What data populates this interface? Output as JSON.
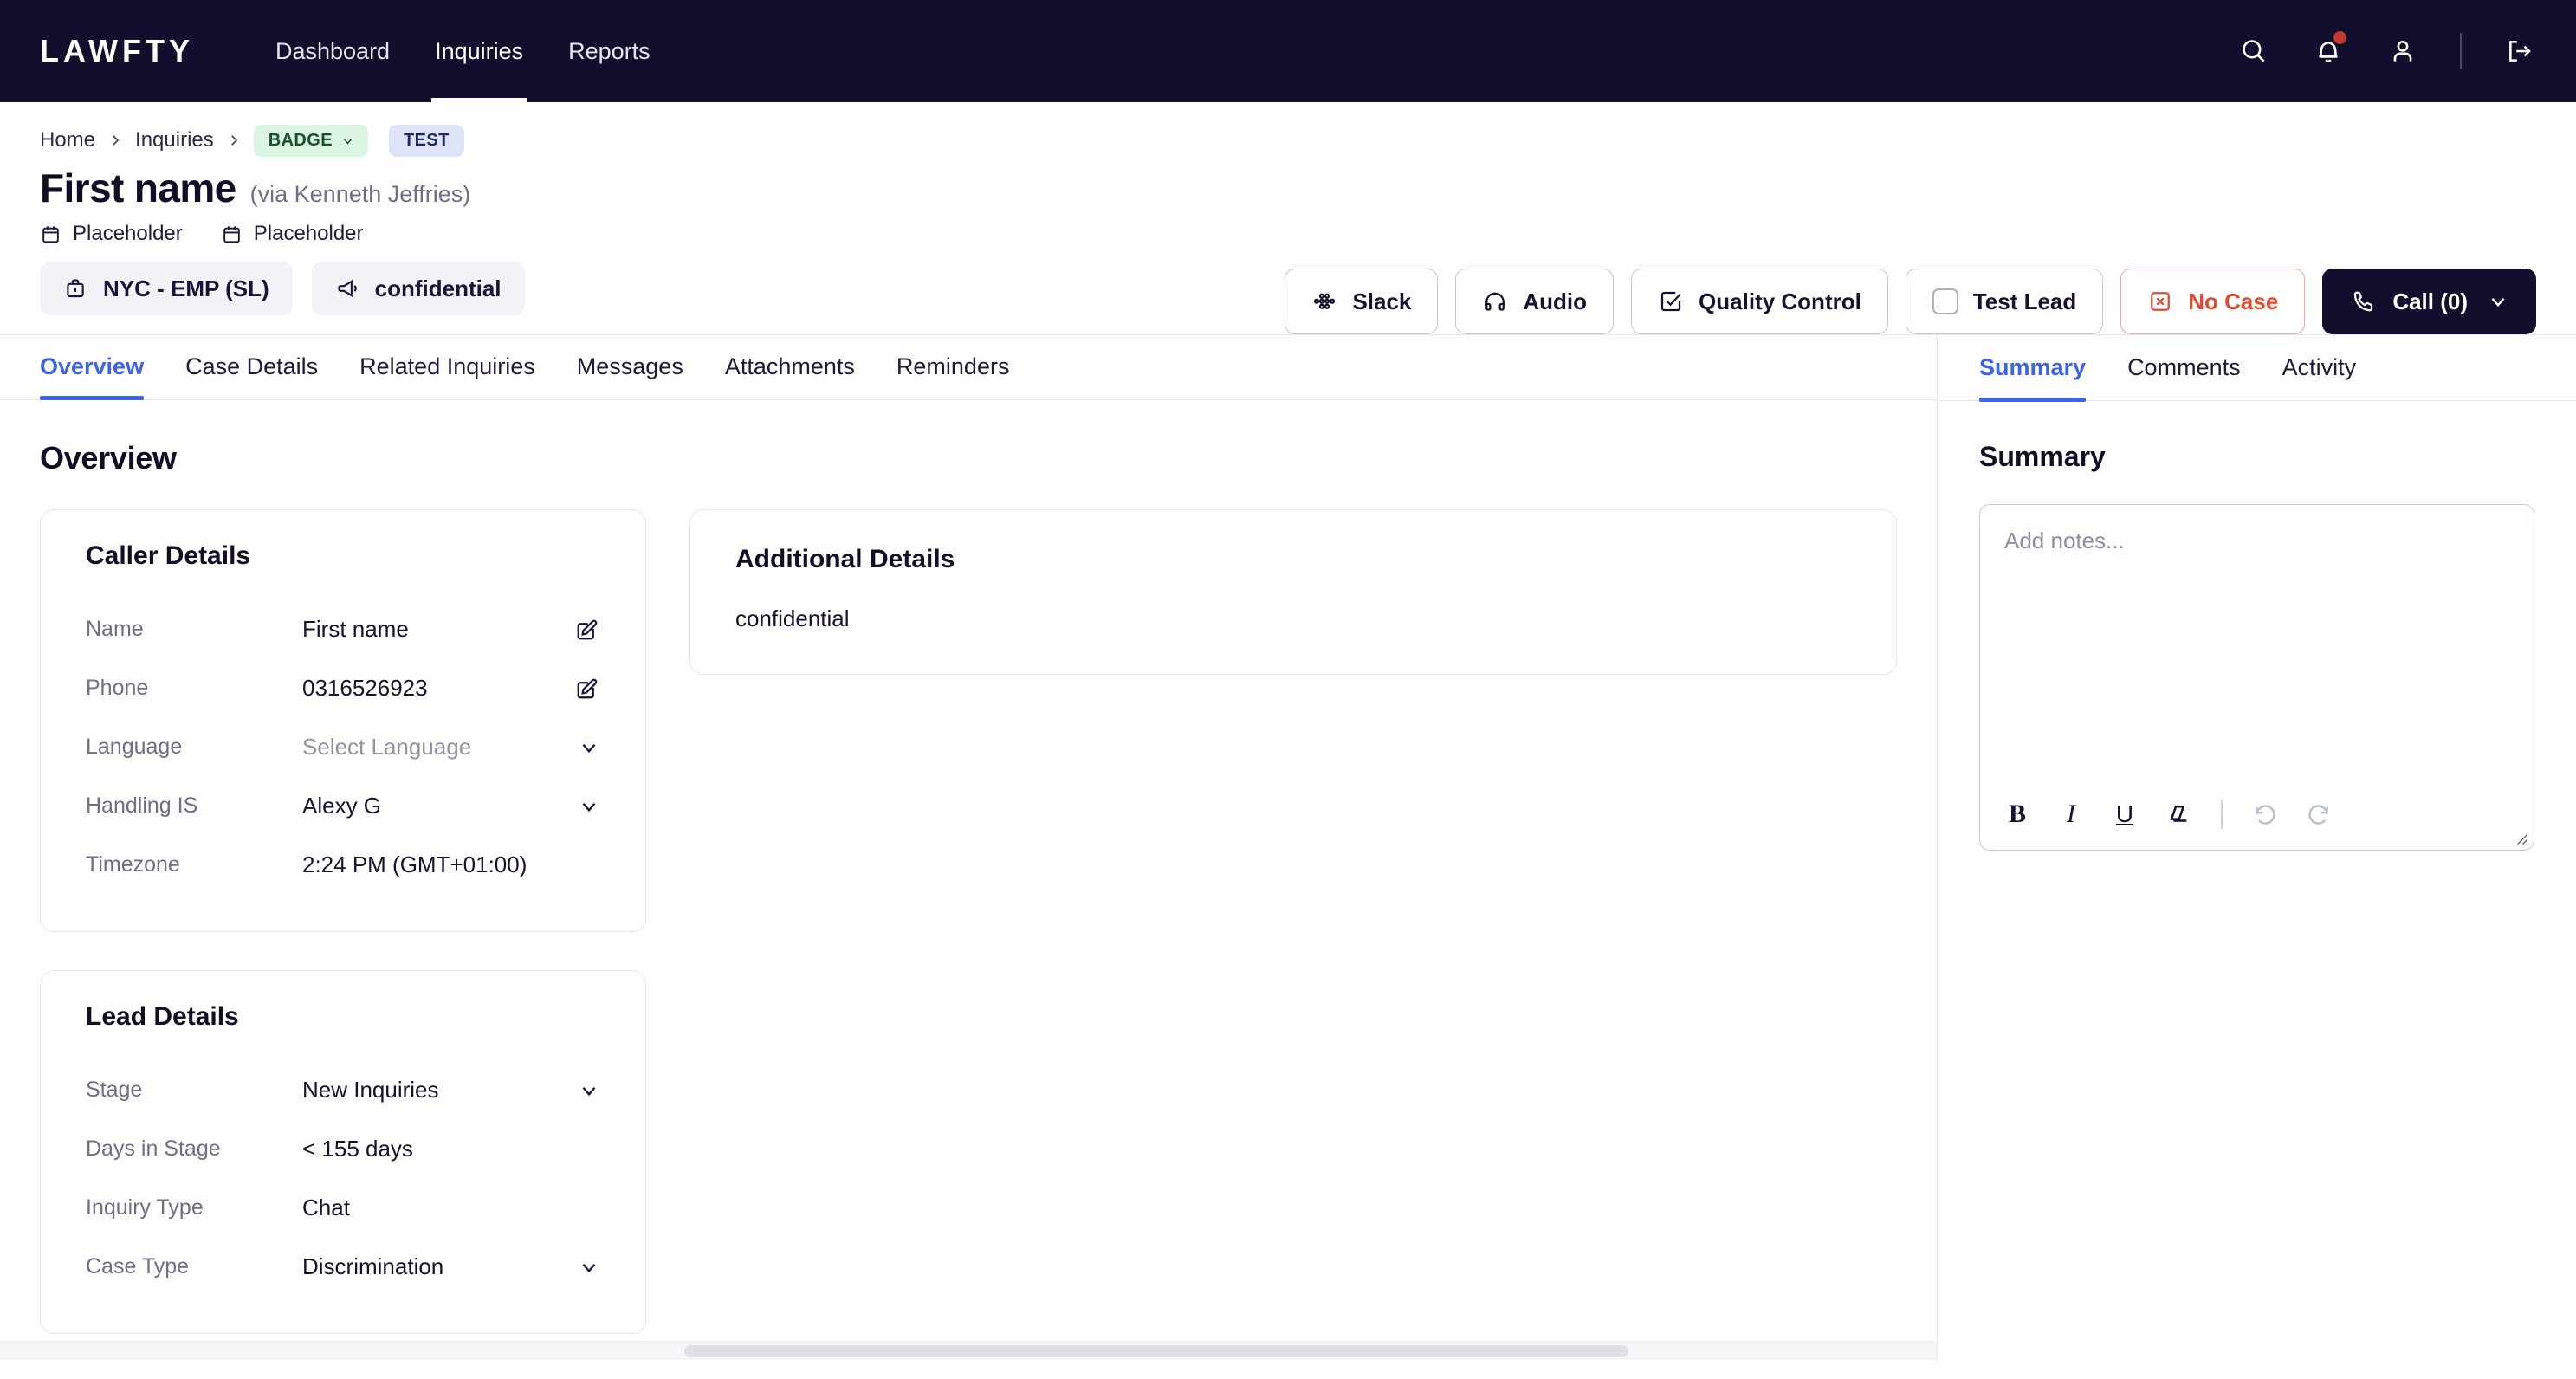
{
  "topnav": {
    "logo": "LAWFTY",
    "links": [
      {
        "label": "Dashboard",
        "active": false
      },
      {
        "label": "Inquiries",
        "active": true
      },
      {
        "label": "Reports",
        "active": false
      }
    ],
    "icons": [
      "search-icon",
      "notifications-bell-icon",
      "user-account-icon",
      "logout-icon"
    ],
    "notification_dot_color": "#c0392b"
  },
  "header": {
    "breadcrumb": {
      "home": "Home",
      "inquiries": "Inquiries",
      "badge": "BADGE",
      "test": "TEST",
      "badge_bg": "#dcf5e3",
      "badge_color": "#14532d",
      "test_bg": "#dfe3f7",
      "test_color": "#1d2a5e"
    },
    "title": "First name",
    "title_via": "(via Kenneth Jeffries)",
    "meta": [
      {
        "icon": "calendar-icon",
        "label": "Placeholder"
      },
      {
        "icon": "calendar-icon",
        "label": "Placeholder"
      }
    ],
    "actions": [
      {
        "id": "slack",
        "label": "Slack",
        "icon": "slack-icon",
        "style": "default"
      },
      {
        "id": "audio",
        "label": "Audio",
        "icon": "headphones-icon",
        "style": "default"
      },
      {
        "id": "quality-control",
        "label": "Quality Control",
        "icon": "check-square-icon",
        "style": "default"
      },
      {
        "id": "test-lead",
        "label": "Test Lead",
        "icon": "checkbox-empty-icon",
        "style": "default"
      },
      {
        "id": "no-case",
        "label": "No Case",
        "icon": "x-square-icon",
        "style": "danger"
      },
      {
        "id": "call",
        "label": "Call (0)",
        "icon": "phone-icon",
        "style": "dark"
      }
    ]
  },
  "chips": [
    {
      "icon": "briefcase-icon",
      "label": "NYC - EMP (SL)"
    },
    {
      "icon": "megaphone-icon",
      "label": "confidential"
    }
  ],
  "main": {
    "tabs": [
      {
        "label": "Overview",
        "active": true
      },
      {
        "label": "Case Details",
        "active": false
      },
      {
        "label": "Related Inquiries",
        "active": false
      },
      {
        "label": "Messages",
        "active": false
      },
      {
        "label": "Attachments",
        "active": false
      },
      {
        "label": "Reminders",
        "active": false
      }
    ],
    "heading": "Overview",
    "caller_details": {
      "title": "Caller Details",
      "rows": [
        {
          "label": "Name",
          "value": "First name",
          "control": "edit",
          "placeholder": false
        },
        {
          "label": "Phone",
          "value": "0316526923",
          "control": "edit",
          "placeholder": false
        },
        {
          "label": "Language",
          "value": "Select Language",
          "control": "chevron",
          "placeholder": true
        },
        {
          "label": "Handling IS",
          "value": "Alexy G",
          "control": "chevron",
          "placeholder": false
        },
        {
          "label": "Timezone",
          "value": "2:24 PM (GMT+01:00)",
          "control": "none",
          "placeholder": false
        }
      ]
    },
    "lead_details": {
      "title": "Lead Details",
      "rows": [
        {
          "label": "Stage",
          "value": "New Inquiries",
          "control": "chevron",
          "placeholder": false
        },
        {
          "label": "Days in Stage",
          "value": "< 155 days",
          "control": "none",
          "placeholder": false
        },
        {
          "label": "Inquiry Type",
          "value": "Chat",
          "control": "none",
          "placeholder": false
        },
        {
          "label": "Case Type",
          "value": "Discrimination",
          "control": "chevron",
          "placeholder": false
        }
      ]
    },
    "additional_details": {
      "title": "Additional Details",
      "body": "confidential"
    }
  },
  "side": {
    "tabs": [
      {
        "label": "Summary",
        "active": true
      },
      {
        "label": "Comments",
        "active": false
      },
      {
        "label": "Activity",
        "active": false
      }
    ],
    "heading": "Summary",
    "editor": {
      "placeholder": "Add notes...",
      "toolbar": [
        {
          "id": "bold",
          "glyph": "B"
        },
        {
          "id": "italic",
          "glyph": "I"
        },
        {
          "id": "underline",
          "glyph": "U"
        },
        {
          "id": "highlight",
          "glyph": ""
        },
        {
          "id": "undo",
          "glyph": ""
        },
        {
          "id": "redo",
          "glyph": ""
        }
      ]
    }
  },
  "theme": {
    "nav_bg": "#120f2e",
    "accent": "#3b63f0",
    "danger": "#e14a2e",
    "muted": "#6f6e87"
  }
}
